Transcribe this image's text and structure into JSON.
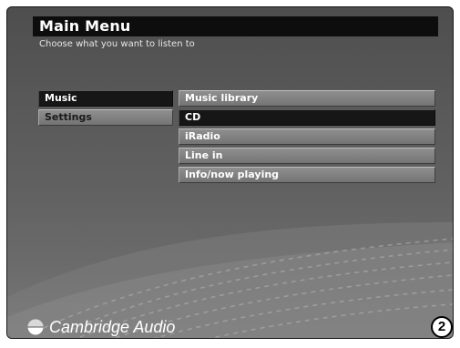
{
  "header": {
    "title": "Main Menu",
    "subtitle": "Choose what you want to listen to"
  },
  "left_menu": {
    "selected": "Music",
    "items": [
      {
        "label": "Music",
        "state": "selected"
      },
      {
        "label": "Settings",
        "state": "inactive"
      }
    ]
  },
  "right_menu": {
    "selected": "CD",
    "items": [
      {
        "label": "Music library",
        "state": "normal"
      },
      {
        "label": "CD",
        "state": "selected"
      },
      {
        "label": "iRadio",
        "state": "normal"
      },
      {
        "label": "Line in",
        "state": "normal"
      },
      {
        "label": "Info/now playing",
        "state": "normal"
      }
    ]
  },
  "brand": {
    "name": "Cambridge Audio",
    "logo_icon": "cambridge-audio-logo-icon"
  },
  "figure_badge": {
    "text": "2"
  },
  "colors": {
    "background_top": "#4e4e4e",
    "background_bottom": "#7a7a7a",
    "header_bar": "#0d0d0d",
    "item_normal": "#808080",
    "item_selected": "#161616",
    "text_primary": "#ffffff",
    "text_inactive": "#1a1a1a"
  }
}
